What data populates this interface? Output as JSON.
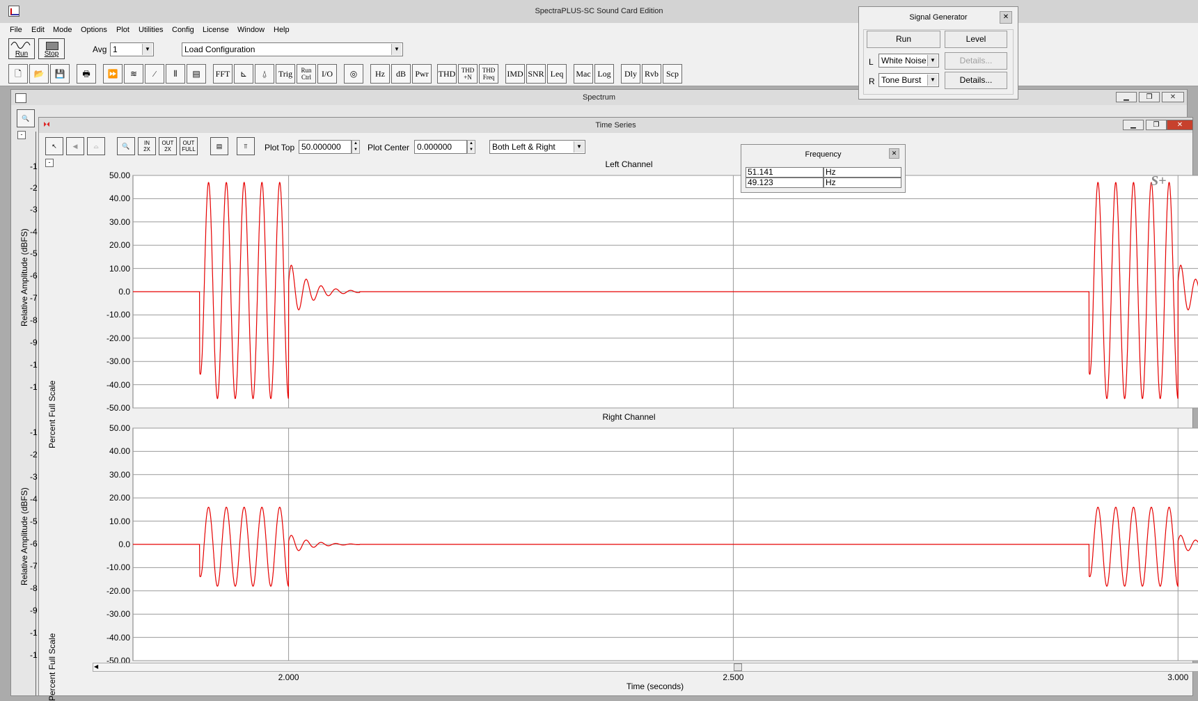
{
  "app": {
    "title": "SpectraPLUS-SC Sound Card Edition"
  },
  "menu": [
    "File",
    "Edit",
    "Mode",
    "Options",
    "Plot",
    "Utilities",
    "Config",
    "License",
    "Window",
    "Help"
  ],
  "toolbar": {
    "run_label": "Run",
    "stop_label": "Stop",
    "avg_label": "Avg",
    "avg_value": "1",
    "config_value": "Load Configuration",
    "buttons": [
      "FFT",
      "Trig",
      "Run Ctrl",
      "I/O",
      "Hz",
      "dB",
      "Pwr",
      "THD",
      "THD +N",
      "THD Freq",
      "IMD",
      "SNR",
      "Leq",
      "Mac",
      "Log",
      "Dly",
      "Rvb",
      "Scp"
    ]
  },
  "spectrum_window": {
    "title": "Spectrum",
    "ylabel": "Relative Amplitude (dBFS)",
    "top_ticks": [
      "-1",
      "-2",
      "-3",
      "-4",
      "-5",
      "-6",
      "-7",
      "-8",
      "-9",
      "-1",
      "-1"
    ],
    "bottom_ticks": [
      "-1",
      "-2",
      "-3",
      "-4",
      "-5",
      "-6",
      "-7",
      "-8",
      "-9",
      "-1",
      "-1"
    ]
  },
  "time_series": {
    "title": "Time Series",
    "plot_top_label": "Plot Top",
    "plot_top_value": "50.000000",
    "plot_center_label": "Plot Center",
    "plot_center_value": "0.000000",
    "channel_select": "Both Left & Right",
    "logo": "S+"
  },
  "frequency_box": {
    "title": "Frequency",
    "rows": [
      {
        "value": "51.141",
        "unit": "Hz"
      },
      {
        "value": "49.123",
        "unit": "Hz"
      }
    ]
  },
  "signal_generator": {
    "title": "Signal Generator",
    "run_label": "Run",
    "level_label": "Level",
    "left_label": "L",
    "left_value": "White Noise",
    "right_label": "R",
    "right_value": "Tone Burst",
    "details_label": "Details..."
  },
  "chart_data": [
    {
      "type": "line",
      "title": "Left Channel",
      "ylabel": "Percent Full Scale",
      "xlabel": "",
      "ylim": [
        -50,
        50
      ],
      "xlim": [
        1.825,
        3.035
      ],
      "yticks": [
        "50.00",
        "40.00",
        "30.00",
        "20.00",
        "10.00",
        "0.0",
        "-10.00",
        "-20.00",
        "-30.00",
        "-40.00",
        "-50.00"
      ],
      "grid": true,
      "series": [
        {
          "color": "#e60000",
          "burst_starts": [
            1.9,
            2.9
          ],
          "burst_frequency_hz": 50,
          "burst_cycles": 5,
          "peak_positive": 47,
          "peak_negative": -46
        }
      ]
    },
    {
      "type": "line",
      "title": "Right Channel",
      "ylabel": "Percent Full Scale",
      "xlabel": "Time (seconds)",
      "ylim": [
        -50,
        50
      ],
      "xlim": [
        1.825,
        3.035
      ],
      "yticks": [
        "50.00",
        "40.00",
        "30.00",
        "20.00",
        "10.00",
        "0.0",
        "-10.00",
        "-20.00",
        "-30.00",
        "-40.00",
        "-50.00"
      ],
      "xticks": [
        "2.000",
        "2.500",
        "3.000"
      ],
      "xtick_values": [
        2.0,
        2.5,
        3.0
      ],
      "grid": true,
      "series": [
        {
          "color": "#e60000",
          "burst_starts": [
            1.9,
            2.9
          ],
          "burst_frequency_hz": 50,
          "burst_cycles": 5,
          "peak_positive": 16,
          "peak_negative": -18
        }
      ]
    }
  ]
}
